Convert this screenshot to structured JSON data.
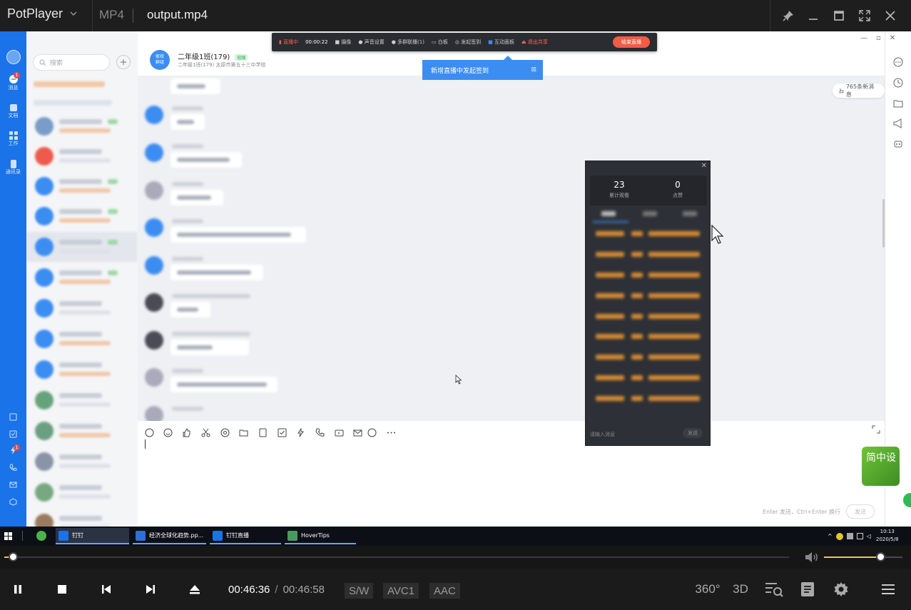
{
  "player": {
    "app_name": "PotPlayer",
    "format": "MP4",
    "file_name": "output.mp4",
    "current_time": "00:46:36",
    "separator": "/",
    "duration": "00:46:58",
    "codec_tags": [
      "S/W",
      "AVC1",
      "AAC"
    ],
    "seek_progress": 0.011,
    "volume_level": 0.72,
    "right_buttons": [
      "360°",
      "3D",
      "playlist-search-icon",
      "chapter-icon",
      "settings-gear-icon",
      "menu-icon"
    ]
  },
  "dingtalk": {
    "search_placeholder": "搜索",
    "rail": [
      {
        "label": "消息",
        "badge": "1"
      },
      {
        "label": "文档"
      },
      {
        "label": "工作"
      },
      {
        "label": "通讯录"
      }
    ],
    "rail_bottom_badge": "1",
    "chat_title": "二年级1班(179)",
    "chat_tag": "班级",
    "chat_subtitle": "二年级1班(179) 太原市第五十三中学校",
    "new_messages": "765条新消息",
    "input_hint": "Enter 发送，Ctrl+Enter 换行",
    "send_label": "发送"
  },
  "live_bar": {
    "status": "直播中",
    "time": "00:00:22",
    "items": [
      "摄像",
      "声音设置",
      "多群联播(1)",
      "白板",
      "发起签到",
      "互动面板",
      "退出共享"
    ],
    "stop_label": "结束直播"
  },
  "tooltip": {
    "text": "新增直播中发起签到"
  },
  "viewer_panel": {
    "views_value": "23",
    "views_label": "累计观看",
    "likes_value": "0",
    "likes_label": "点赞",
    "input_placeholder": "请输入消息",
    "send_label": "发送"
  },
  "green_logo": {
    "text": "简中设"
  },
  "taskbar": {
    "tasks": [
      {
        "label": "钉钉",
        "color": "#1a73e8"
      },
      {
        "label": "经济全球化趋势.pp...",
        "color": "#2f6fd6"
      },
      {
        "label": "钉钉直播",
        "color": "#1a73e8"
      },
      {
        "label": "HoverTips",
        "color": "#4a9a60"
      }
    ],
    "clock_time": "10:13",
    "clock_date": "2020/5/8"
  }
}
